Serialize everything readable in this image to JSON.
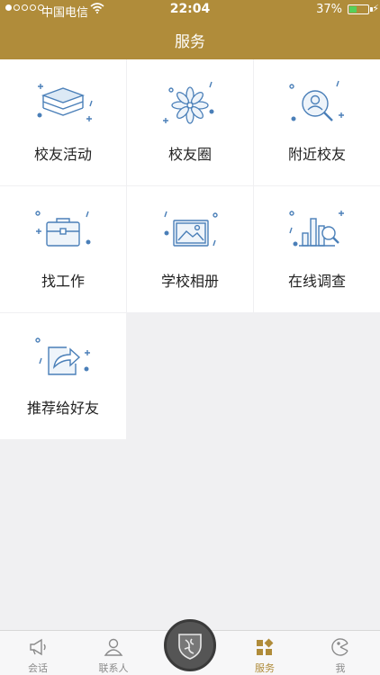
{
  "status_bar": {
    "carrier": "中国电信",
    "time": "22:04",
    "battery": "37%",
    "battery_level": 0.37
  },
  "nav": {
    "title": "服务"
  },
  "services": [
    {
      "label": "校友活动",
      "icon": "layers-icon"
    },
    {
      "label": "校友圈",
      "icon": "flower-icon"
    },
    {
      "label": "附近校友",
      "icon": "user-search-icon"
    },
    {
      "label": "找工作",
      "icon": "briefcase-icon"
    },
    {
      "label": "学校相册",
      "icon": "photo-album-icon"
    },
    {
      "label": "在线调查",
      "icon": "chart-search-icon"
    },
    {
      "label": "推荐给好友",
      "icon": "share-icon"
    }
  ],
  "tabbar": {
    "tabs": [
      {
        "label": "会话",
        "icon": "megaphone-icon",
        "active": false
      },
      {
        "label": "联系人",
        "icon": "person-icon",
        "active": false
      },
      {
        "label": "服务",
        "icon": "apps-icon",
        "active": true
      },
      {
        "label": "我",
        "icon": "profile-icon",
        "active": false
      }
    ]
  },
  "colors": {
    "brand": "#b08c3a",
    "icon": "#4a7fb8",
    "background": "#f0f0f2"
  }
}
